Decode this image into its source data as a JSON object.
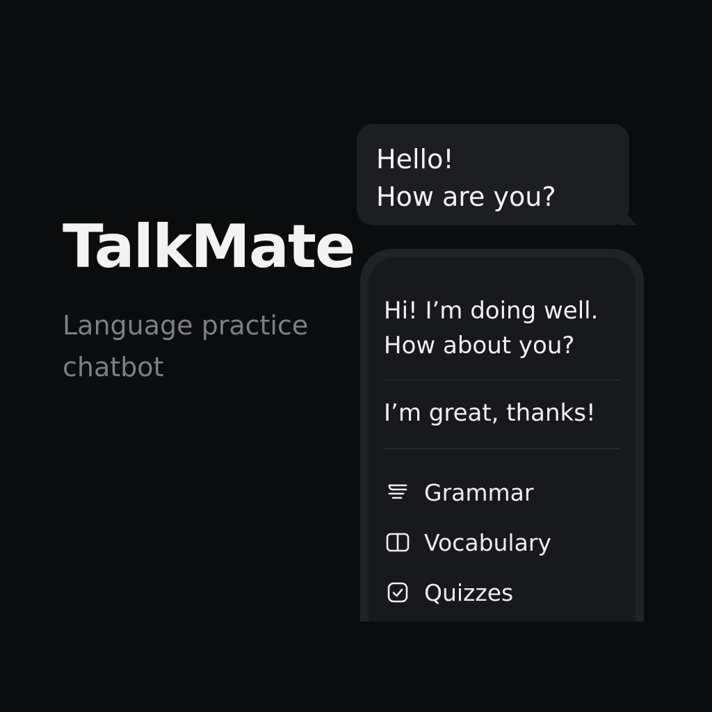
{
  "brand": {
    "title": "TalkMate",
    "subtitle": "Language practice chatbot"
  },
  "incoming_bubble": {
    "lines": [
      "Hello!",
      "How are you?"
    ]
  },
  "chat": {
    "bot_reply_lines": [
      "Hi! I’m doing well.",
      "How about you?"
    ],
    "user_message": "I’m great, thanks!"
  },
  "features": [
    {
      "label": "Grammar",
      "icon": "grammar-lines-icon"
    },
    {
      "label": "Vocabulary",
      "icon": "book-icon"
    },
    {
      "label": "Quizzes",
      "icon": "check-square-icon"
    }
  ],
  "colors": {
    "background": "#0b0c0d",
    "bubble": "#1c1e21",
    "phone_frame": "#202225",
    "phone_screen": "#17191c",
    "text_primary": "#f2f2f2",
    "text_muted": "#7d7f83"
  }
}
